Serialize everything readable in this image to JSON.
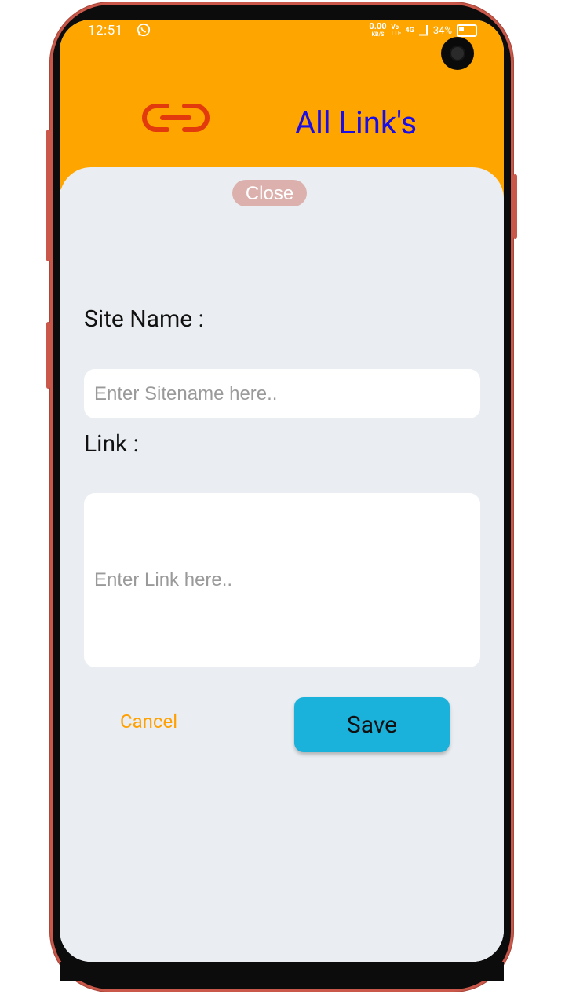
{
  "status_bar": {
    "time": "12:51",
    "net_speed": "0.00",
    "net_unit": "KB/S",
    "volte": "Vo LTE",
    "signal": "4G",
    "battery": "34%"
  },
  "header": {
    "title": "All Link's",
    "background_color": "#ffa500",
    "title_color": "#1a0de6",
    "icon": "link-icon",
    "icon_color": "#e23a0c"
  },
  "dialog": {
    "close_label": "Close",
    "site_name_label": "Site Name :",
    "site_name_placeholder": "Enter Sitename  here..",
    "link_label": "Link  :",
    "link_placeholder": "Enter Link here..",
    "cancel_label": "Cancel",
    "save_label": "Save",
    "save_color": "#1ab1db",
    "cancel_color": "#ffa000"
  }
}
